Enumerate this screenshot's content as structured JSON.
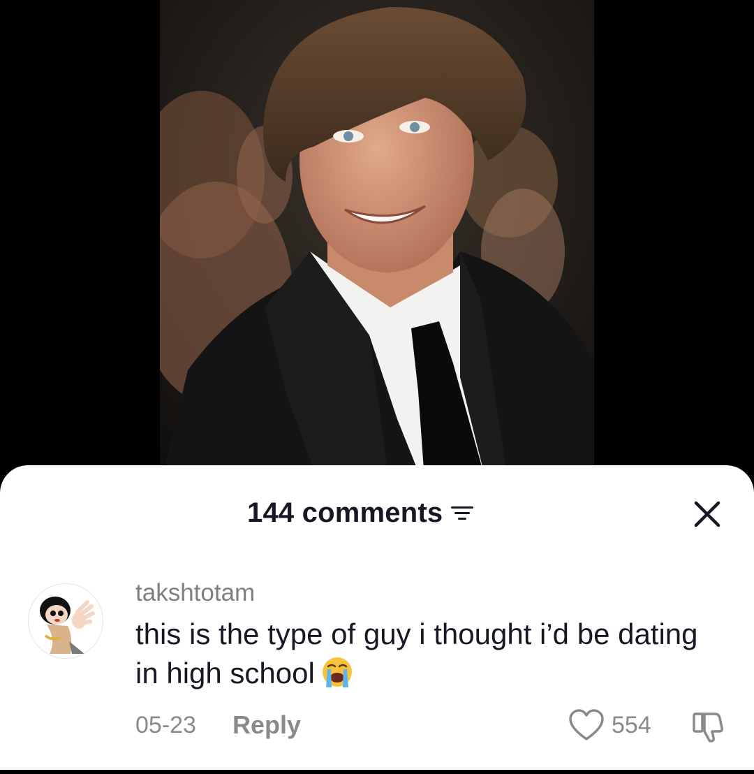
{
  "sheet": {
    "comments_label": "144 comments"
  },
  "comment": {
    "username": "takshtotam",
    "text": "this is the type of guy i thought i’d be dating in high school",
    "date": "05-23",
    "reply_label": "Reply",
    "like_count": "554"
  },
  "icons": {
    "sort": "sort-filter-icon",
    "close": "close-icon",
    "heart": "heart-outline-icon",
    "dislike": "thumbs-down-icon",
    "emoji": "loudly-crying-face-emoji"
  }
}
